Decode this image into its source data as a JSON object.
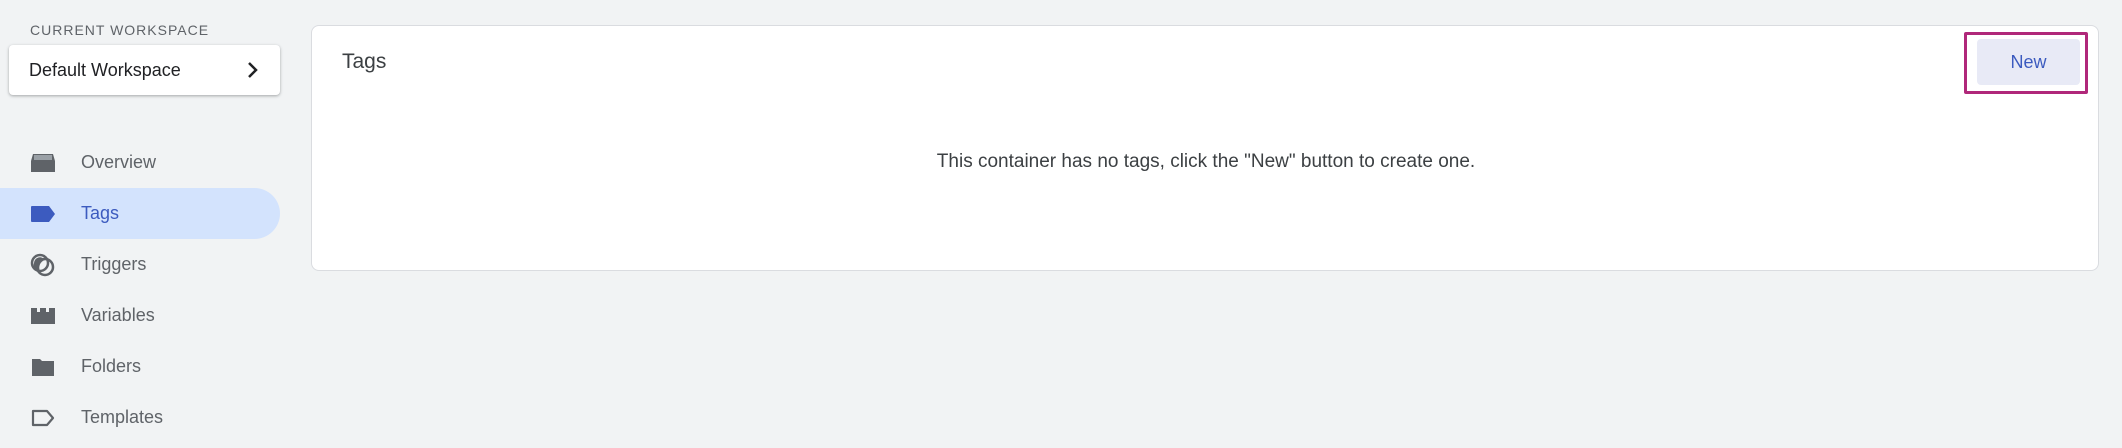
{
  "sidebar": {
    "workspace_label": "CURRENT WORKSPACE",
    "workspace_name": "Default Workspace",
    "items": [
      {
        "label": "Overview",
        "icon": "overview-icon"
      },
      {
        "label": "Tags",
        "icon": "tag-icon",
        "active": true
      },
      {
        "label": "Triggers",
        "icon": "triggers-icon"
      },
      {
        "label": "Variables",
        "icon": "variables-icon"
      },
      {
        "label": "Folders",
        "icon": "folder-icon"
      },
      {
        "label": "Templates",
        "icon": "templates-icon"
      }
    ]
  },
  "main": {
    "title": "Tags",
    "new_button": "New",
    "empty_message": "This container has no tags, click the \"New\" button to create one."
  },
  "colors": {
    "accent": "#3c5bbf",
    "active_bg": "#d3e3fd",
    "highlight_border": "#b0287a",
    "page_bg": "#f1f3f4"
  }
}
